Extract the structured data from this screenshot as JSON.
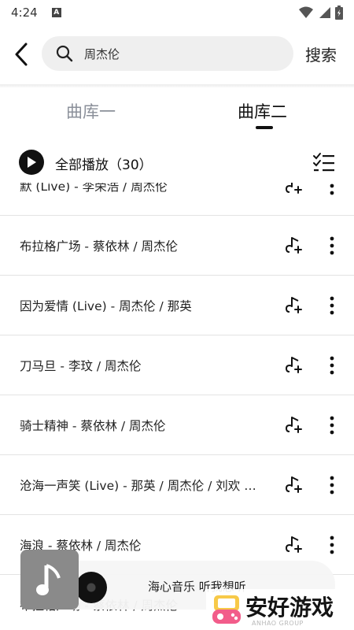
{
  "status_bar": {
    "time": "4:24",
    "notification_icon": "A"
  },
  "search": {
    "query": "周杰伦",
    "submit_label": "搜索"
  },
  "tabs": [
    {
      "label": "曲库一",
      "active": false
    },
    {
      "label": "曲库二",
      "active": true
    }
  ],
  "play_all": {
    "label": "全部播放（30）"
  },
  "songs": [
    {
      "title": "默 (Live) - 李荣浩 / 周杰伦"
    },
    {
      "title": "布拉格广场 - 蔡依林 / 周杰伦"
    },
    {
      "title": "因为爱情 (Live) - 周杰伦 / 那英"
    },
    {
      "title": "刀马旦 - 李玟 / 周杰伦"
    },
    {
      "title": "骑士精神 - 蔡依林 / 周杰伦"
    },
    {
      "title": "沧海一声笑 (Live) - 那英 / 周杰伦 / 刘欢 / …"
    },
    {
      "title": "海浪 - 蔡依林 / 周杰伦"
    },
    {
      "title": "布拉格广场 - 蔡依林 / 周杰伦"
    }
  ],
  "player": {
    "title": "海心音乐 听我想听"
  },
  "watermark": {
    "text": "安好游戏",
    "sub": "ANHAO GROUP"
  },
  "colors": {
    "accent": "#111111",
    "tab_inactive": "#8a8f99",
    "search_bg": "#efefef"
  }
}
